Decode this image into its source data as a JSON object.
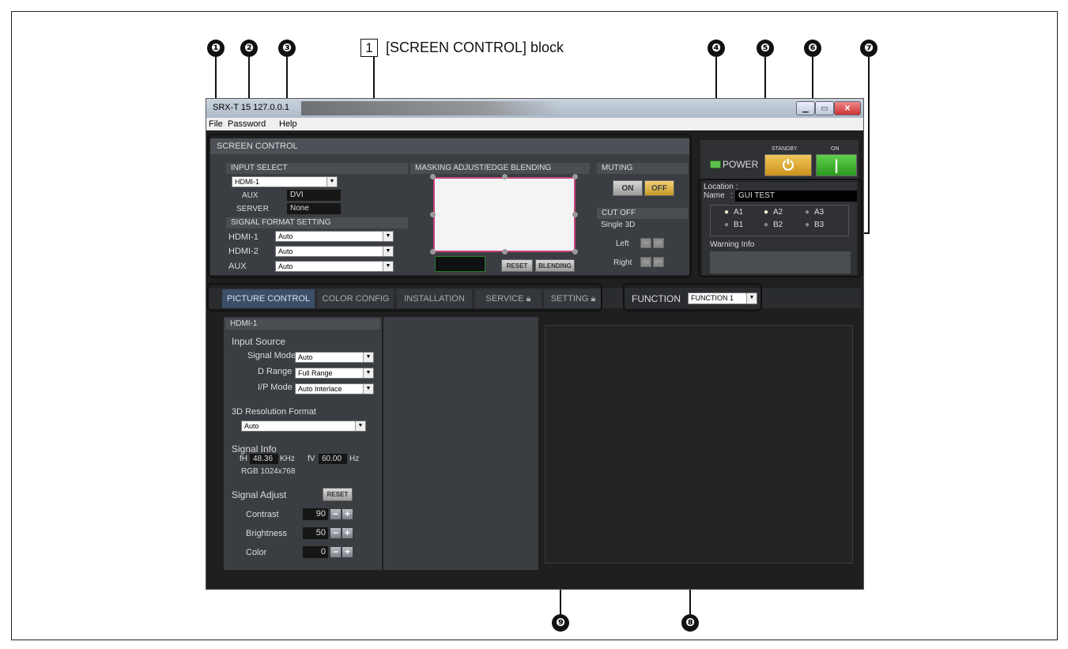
{
  "caption": {
    "number": "1",
    "text": "[SCREEN CONTROL] block"
  },
  "callouts": [
    "❶",
    "❷",
    "❸",
    "❹",
    "❺",
    "❻",
    "❼",
    "❽",
    "❾"
  ],
  "window": {
    "title": "SRX-T 15 127.0.0.1",
    "menu": {
      "file": "File",
      "password": "Password",
      "help": "Help"
    }
  },
  "screen_control": {
    "title": "SCREEN CONTROL",
    "input_select": {
      "header": "INPUT SELECT",
      "value": "HDMI-1",
      "aux_label": "AUX",
      "aux_value": "DVI",
      "server_label": "SERVER",
      "server_value": "None"
    },
    "signal_format": {
      "header": "SIGNAL FORMAT SETTING",
      "rows": [
        {
          "label": "HDMI-1",
          "value": "Auto"
        },
        {
          "label": "HDMI-2",
          "value": "Auto"
        },
        {
          "label": "AUX",
          "value": "Auto"
        }
      ]
    },
    "masking": {
      "header": "MASKING ADJUST/EDGE BLENDING",
      "reset": "RESET",
      "blending": "BLENDING"
    },
    "muting": {
      "header": "MUTING",
      "on": "ON",
      "off": "OFF"
    },
    "cutoff": {
      "header": "CUT OFF",
      "mode": "Single 3D",
      "left": "Left",
      "right": "Right",
      "on": "ON",
      "off": "OFF"
    }
  },
  "power": {
    "label": "POWER",
    "standby": "STANDBY",
    "on": "ON",
    "standby_glyph": "⏻",
    "on_glyph": "|"
  },
  "info": {
    "location_label": "Location :",
    "name_label": "Name",
    "name_sep": ":",
    "name_value": "GUI TEST",
    "lamps": [
      {
        "label": "A1",
        "lit": true
      },
      {
        "label": "A2",
        "lit": true
      },
      {
        "label": "A3",
        "lit": false
      },
      {
        "label": "B1",
        "lit": false
      },
      {
        "label": "B2",
        "lit": false
      },
      {
        "label": "B3",
        "lit": false
      }
    ],
    "warning_label": "Warning Info"
  },
  "tabs": {
    "picture": "PICTURE CONTROL",
    "color": "COLOR CONFIG",
    "installation": "INSTALLATION",
    "service": "SERVICE",
    "setting": "SETTING"
  },
  "function": {
    "label": "FUNCTION",
    "value": "FUNCTION 1"
  },
  "picture": {
    "input": "HDMI-1",
    "input_source": "Input Source",
    "signal_mode_label": "Signal Mode",
    "signal_mode": "Auto",
    "d_range_label": "D Range",
    "d_range": "Full Range",
    "ip_mode_label": "I/P Mode",
    "ip_mode": "Auto Interlace",
    "res_format_label": "3D Resolution Format",
    "res_format": "Auto",
    "signal_info": "Signal Info",
    "fh_label": "fH",
    "fh_value": "48.36",
    "fh_unit": "KHz",
    "fv_label": "fV",
    "fv_value": "60.00",
    "fv_unit": "Hz",
    "signal_type": "RGB 1024x768",
    "signal_adjust": "Signal Adjust",
    "reset": "RESET",
    "adjust_rows": [
      {
        "label": "Contrast",
        "value": "90"
      },
      {
        "label": "Brightness",
        "value": "50"
      },
      {
        "label": "Color",
        "value": "0"
      }
    ],
    "minus": "−",
    "plus": "+"
  }
}
